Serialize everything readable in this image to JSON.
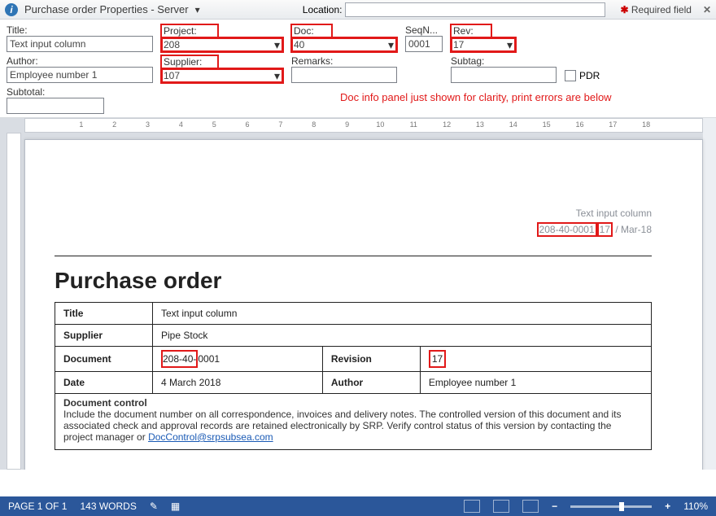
{
  "header": {
    "title": "Purchase order Properties - Server",
    "location_label": "Location:",
    "required_label": "Required field"
  },
  "props": {
    "title_label": "Title:",
    "title_value": "Text input column",
    "project_label": "Project:",
    "project_value": "208",
    "doc_label": "Doc:",
    "doc_value": "40",
    "seqn_label": "SeqN...",
    "seqn_value": "0001",
    "rev_label": "Rev:",
    "rev_value": "17",
    "author_label": "Author:",
    "author_value": "Employee number 1",
    "supplier_label": "Supplier:",
    "supplier_value": "107",
    "remarks_label": "Remarks:",
    "remarks_value": "",
    "subtag_label": "Subtag:",
    "subtag_value": "",
    "pdr_label": "PDR",
    "subtotal_label": "Subtotal:",
    "subtotal_value": ""
  },
  "annotation": "Doc info panel just shown for clarity, print errors are below",
  "page": {
    "top_text1": "Text input column",
    "code_p1": "208-40-",
    "code_p2": "0001",
    "code_p3": "17",
    "code_tail": " / Mar-18",
    "h1": "Purchase order",
    "tbl": {
      "title_k": "Title",
      "title_v": "Text input column",
      "supplier_k": "Supplier",
      "supplier_v": "Pipe Stock",
      "document_k": "Document",
      "document_v1": "208-40-",
      "document_v2": "0001",
      "revision_k": "Revision",
      "revision_v": "17",
      "date_k": "Date",
      "date_v": "4 March 2018",
      "author_k": "Author",
      "author_v": "Employee number 1"
    },
    "docctl_title": "Document control",
    "docctl_body1": "Include the document number on all correspondence, invoices and delivery notes. The controlled version of this document and its associated check and approval records are retained electronically by SRP. Verify control status of this version by contacting the project manager or ",
    "docctl_link": "DocControl@srpsubsea.com"
  },
  "status": {
    "page": "PAGE 1 OF 1",
    "words": "143 WORDS",
    "zoom": "110%"
  }
}
